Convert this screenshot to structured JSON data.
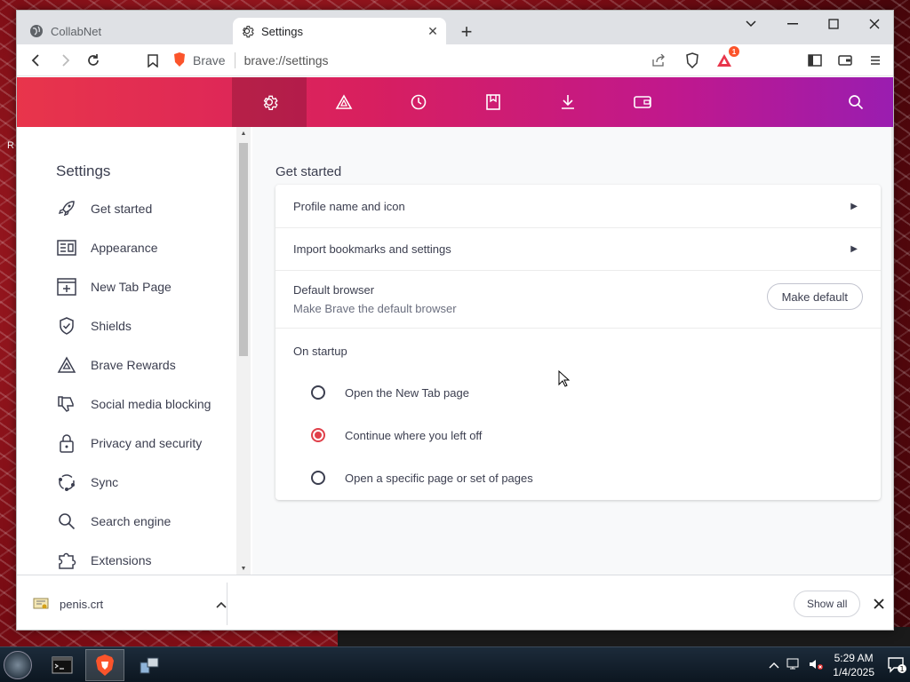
{
  "tabs": [
    {
      "label": "CollabNet",
      "active": false,
      "icon": "globe-icon"
    },
    {
      "label": "Settings",
      "active": true,
      "icon": "gear-icon"
    }
  ],
  "toolbar": {
    "site_name": "Brave",
    "url": "brave://settings",
    "rewards_badge": "1"
  },
  "header_nav": [
    {
      "icon": "gear-icon",
      "selected": true
    },
    {
      "icon": "rewards-triangle-icon",
      "selected": false
    },
    {
      "icon": "history-icon",
      "selected": false
    },
    {
      "icon": "bookmarks-icon",
      "selected": false
    },
    {
      "icon": "downloads-icon",
      "selected": false
    },
    {
      "icon": "wallet-icon",
      "selected": false
    }
  ],
  "sidebar": {
    "title": "Settings",
    "items": [
      {
        "label": "Get started",
        "icon": "rocket-icon"
      },
      {
        "label": "Appearance",
        "icon": "appearance-icon"
      },
      {
        "label": "New Tab Page",
        "icon": "new-tab-icon"
      },
      {
        "label": "Shields",
        "icon": "shield-icon"
      },
      {
        "label": "Brave Rewards",
        "icon": "rewards-triangle-icon"
      },
      {
        "label": "Social media blocking",
        "icon": "thumbs-down-icon"
      },
      {
        "label": "Privacy and security",
        "icon": "lock-icon"
      },
      {
        "label": "Sync",
        "icon": "sync-icon"
      },
      {
        "label": "Search engine",
        "icon": "search-icon"
      },
      {
        "label": "Extensions",
        "icon": "puzzle-icon"
      }
    ]
  },
  "main": {
    "section_title": "Get started",
    "profile_row": "Profile name and icon",
    "import_row": "Import bookmarks and settings",
    "default_browser": {
      "title": "Default browser",
      "subtitle": "Make Brave the default browser",
      "button": "Make default"
    },
    "startup": {
      "title": "On startup",
      "options": [
        {
          "label": "Open the New Tab page",
          "checked": false
        },
        {
          "label": "Continue where you left off",
          "checked": true
        },
        {
          "label": "Open a specific page or set of pages",
          "checked": false
        }
      ]
    }
  },
  "download_bar": {
    "file_name": "penis.crt",
    "show_all": "Show all"
  },
  "taskbar": {
    "time": "5:29 AM",
    "date": "1/4/2025",
    "notification_count": "1"
  },
  "desktop": {
    "stray_text": "R"
  },
  "colors": {
    "accent": "#e0404a",
    "header_start": "#e8354b",
    "header_end": "#9a1db0"
  }
}
